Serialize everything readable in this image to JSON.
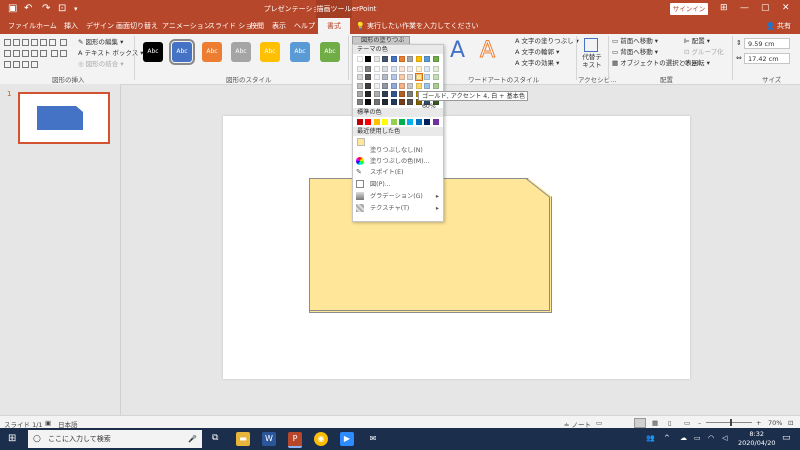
{
  "titlebar": {
    "title": "プレゼンテーション1 - PowerPoint",
    "context_label": "描画ツール",
    "signin": "サインイン"
  },
  "tabs": [
    "ファイル",
    "ホーム",
    "挿入",
    "デザイン",
    "画面切り替え",
    "アニメーション",
    "スライド ショー",
    "校閲",
    "表示",
    "ヘルプ"
  ],
  "active_tab": "書式",
  "tellme": "実行したい作業を入力してください",
  "share": "共有",
  "ribbon": {
    "edit_shape": "図形の編集",
    "textbox": "テキスト ボックス",
    "merge_shapes": "図形の結合",
    "group_insert": "図形の挿入",
    "style_label": "Abc",
    "group_styles": "図形のスタイル",
    "fill_button": "図形の塗りつぶし",
    "text_fill": "文字の塗りつぶし",
    "text_outline": "文字の輪郭",
    "text_effects": "文字の効果",
    "group_wordart": "ワードアートのスタイル",
    "alt_text": "代替テキスト",
    "group_accessibility": "アクセシビ...",
    "bring_forward": "前面へ移動",
    "send_backward": "背面へ移動",
    "selection_pane": "オブジェクトの選択と表示",
    "align": "配置",
    "group": "グループ化",
    "rotate": "回転",
    "group_arrange": "配置",
    "height": "9.59 cm",
    "width": "17.42 cm",
    "group_size": "サイズ"
  },
  "style_colors": [
    "#000000",
    "#4472c4",
    "#ed7d31",
    "#a5a5a5",
    "#ffc000",
    "#5b9bd5",
    "#70ad47"
  ],
  "dropdown": {
    "theme_colors_header": "テーマの色",
    "standard_colors_header": "標準の色",
    "recent_colors_header": "最近使用した色",
    "no_fill": "塗りつぶしなし(N)",
    "more_colors": "塗りつぶしの色(M)...",
    "eyedropper": "スポイト(E)",
    "picture": "図(P)...",
    "gradient": "グラデーション(G)",
    "texture": "テクスチャ(T)"
  },
  "theme_colors_top": [
    "#ffffff",
    "#000000",
    "#e7e6e6",
    "#44546a",
    "#4472c4",
    "#ed7d31",
    "#a5a5a5",
    "#ffc000",
    "#5b9bd5",
    "#70ad47"
  ],
  "standard_colors": [
    "#c00000",
    "#ff0000",
    "#ffc000",
    "#ffff00",
    "#92d050",
    "#00b050",
    "#00b0f0",
    "#0070c0",
    "#002060",
    "#7030a0"
  ],
  "recent_color": "#ffe699",
  "tooltip": "ゴールド, アクセント 4, 白 + 基本色 60%",
  "slide_pane": {
    "number": "1"
  },
  "statusbar": {
    "slide": "スライド 1/1",
    "language": "日本語",
    "notes": "ノート",
    "zoom": "70%"
  },
  "taskbar": {
    "search_placeholder": "ここに入力して検索",
    "time": "8:32",
    "date": "2020/04/20"
  }
}
